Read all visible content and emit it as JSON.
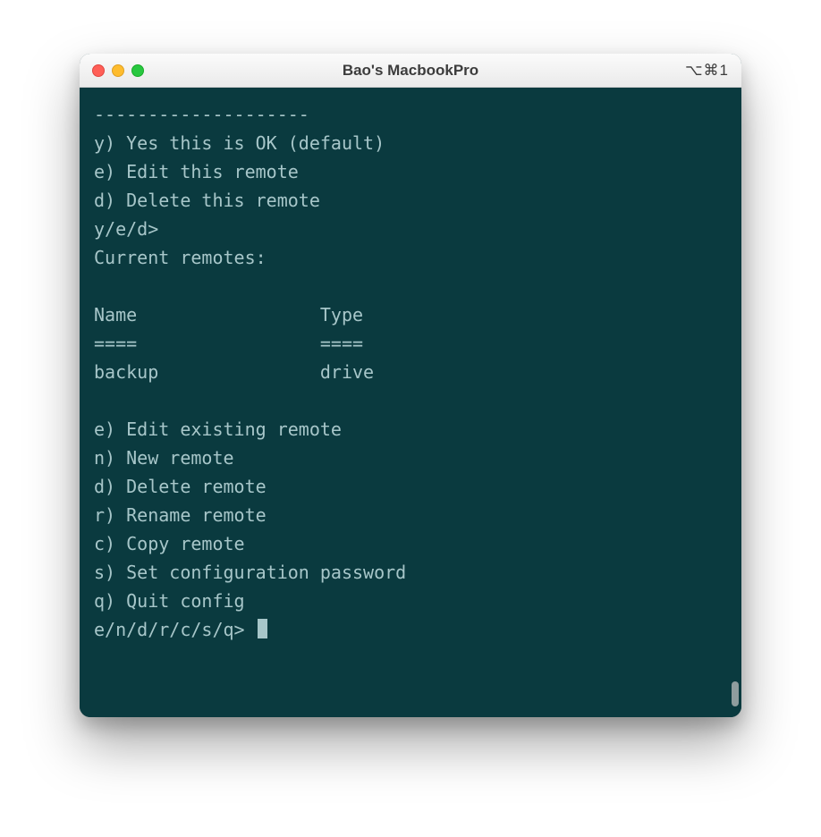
{
  "window": {
    "title": "Bao's MacbookPro",
    "shortcut": "⌥⌘1"
  },
  "terminal": {
    "divider": "--------------------",
    "confirm_options": [
      "y) Yes this is OK (default)",
      "e) Edit this remote",
      "d) Delete this remote"
    ],
    "confirm_prompt": "y/e/d>",
    "current_remotes_header": "Current remotes:",
    "table": {
      "col_name": "Name",
      "col_type": "Type",
      "underline": "====",
      "row_name": "backup",
      "row_type": "drive"
    },
    "menu_options": [
      "e) Edit existing remote",
      "n) New remote",
      "d) Delete remote",
      "r) Rename remote",
      "c) Copy remote",
      "s) Set configuration password",
      "q) Quit config"
    ],
    "menu_prompt": "e/n/d/r/c/s/q>"
  }
}
